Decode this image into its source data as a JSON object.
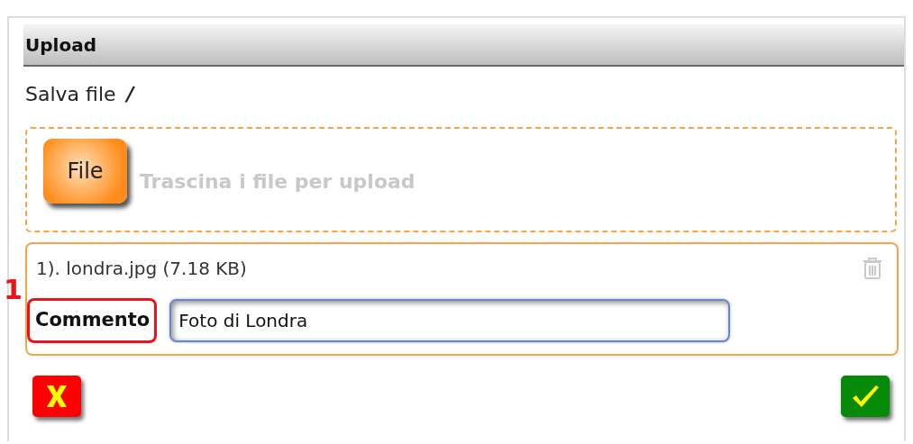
{
  "panel": {
    "title": "Upload"
  },
  "path": {
    "label": "Salva file",
    "value": "/"
  },
  "dropzone": {
    "button": "File",
    "hint": "Trascina i file per upload"
  },
  "files": [
    {
      "name": "1). londra.jpg (7.18 KB)",
      "comment_label": "Commento",
      "comment": "Foto di Londra",
      "callout": "1"
    }
  ]
}
